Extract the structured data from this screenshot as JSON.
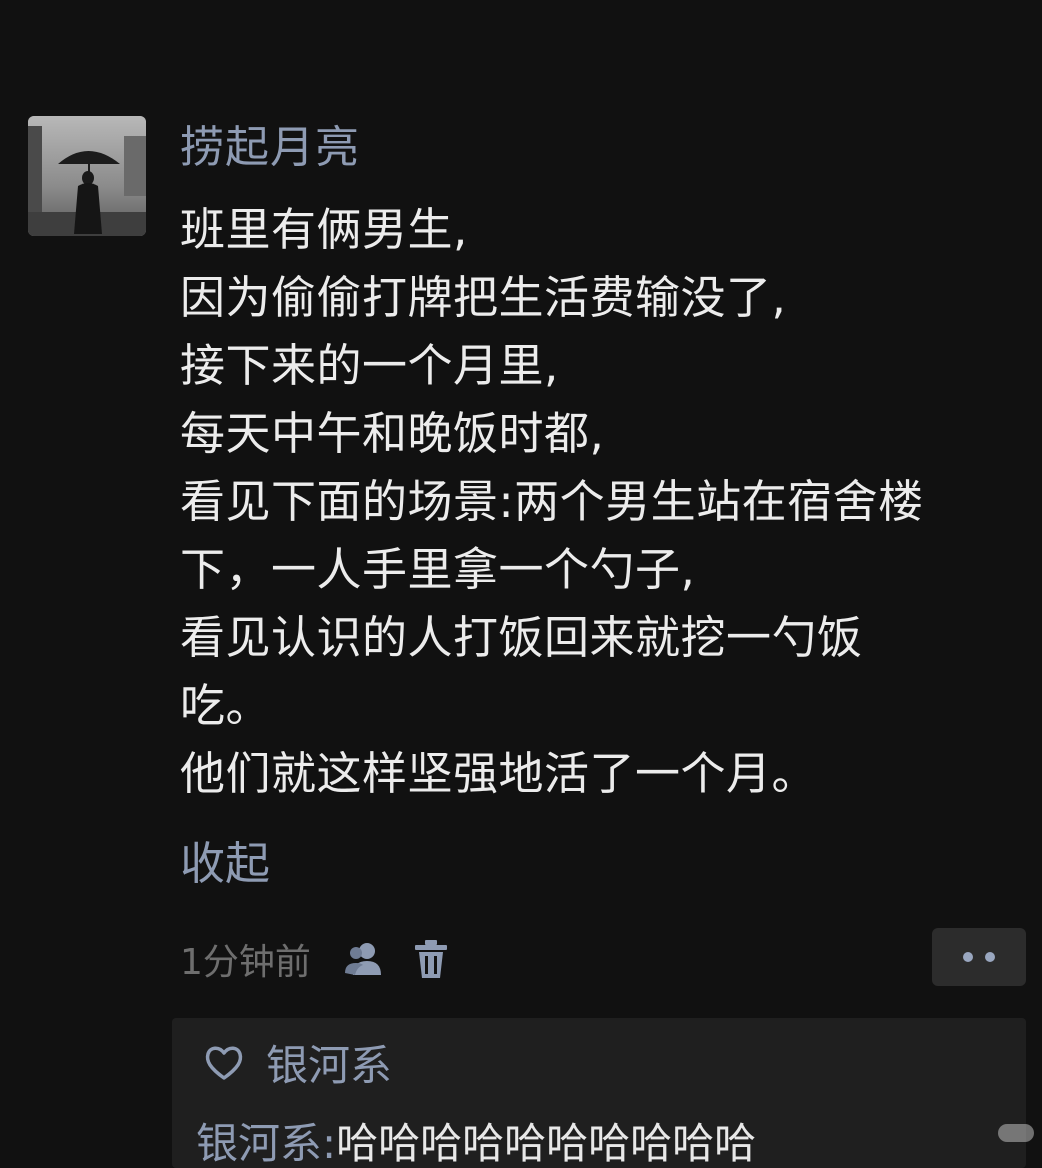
{
  "post": {
    "username": "捞起月亮",
    "lines": [
      "班里有俩男生,",
      "因为偷偷打牌把生活费输没了,",
      "接下来的一个月里,",
      "每天中午和晚饭时都,",
      "看见下面的场景:两个男生站在宿舍楼",
      "下，一人手里拿一个勺子,",
      "看见认识的人打饭回来就挖一勺饭",
      "吃。",
      "他们就这样坚强地活了一个月。"
    ],
    "collapse_label": "收起",
    "timestamp": "1分钟前"
  },
  "icons": {
    "privacy": "people-icon",
    "delete": "trash-icon",
    "more": "more-dots-icon",
    "like": "heart-outline-icon"
  },
  "likes": {
    "user": "银河系"
  },
  "comment": {
    "author": "银河系",
    "separator": ":",
    "text": "哈哈哈哈哈哈哈哈哈哈"
  },
  "colors": {
    "background": "#111111",
    "link": "#8e9bb3",
    "text": "#ececec",
    "meta": "#6e6e6e",
    "panel": "#1f1f1f"
  }
}
